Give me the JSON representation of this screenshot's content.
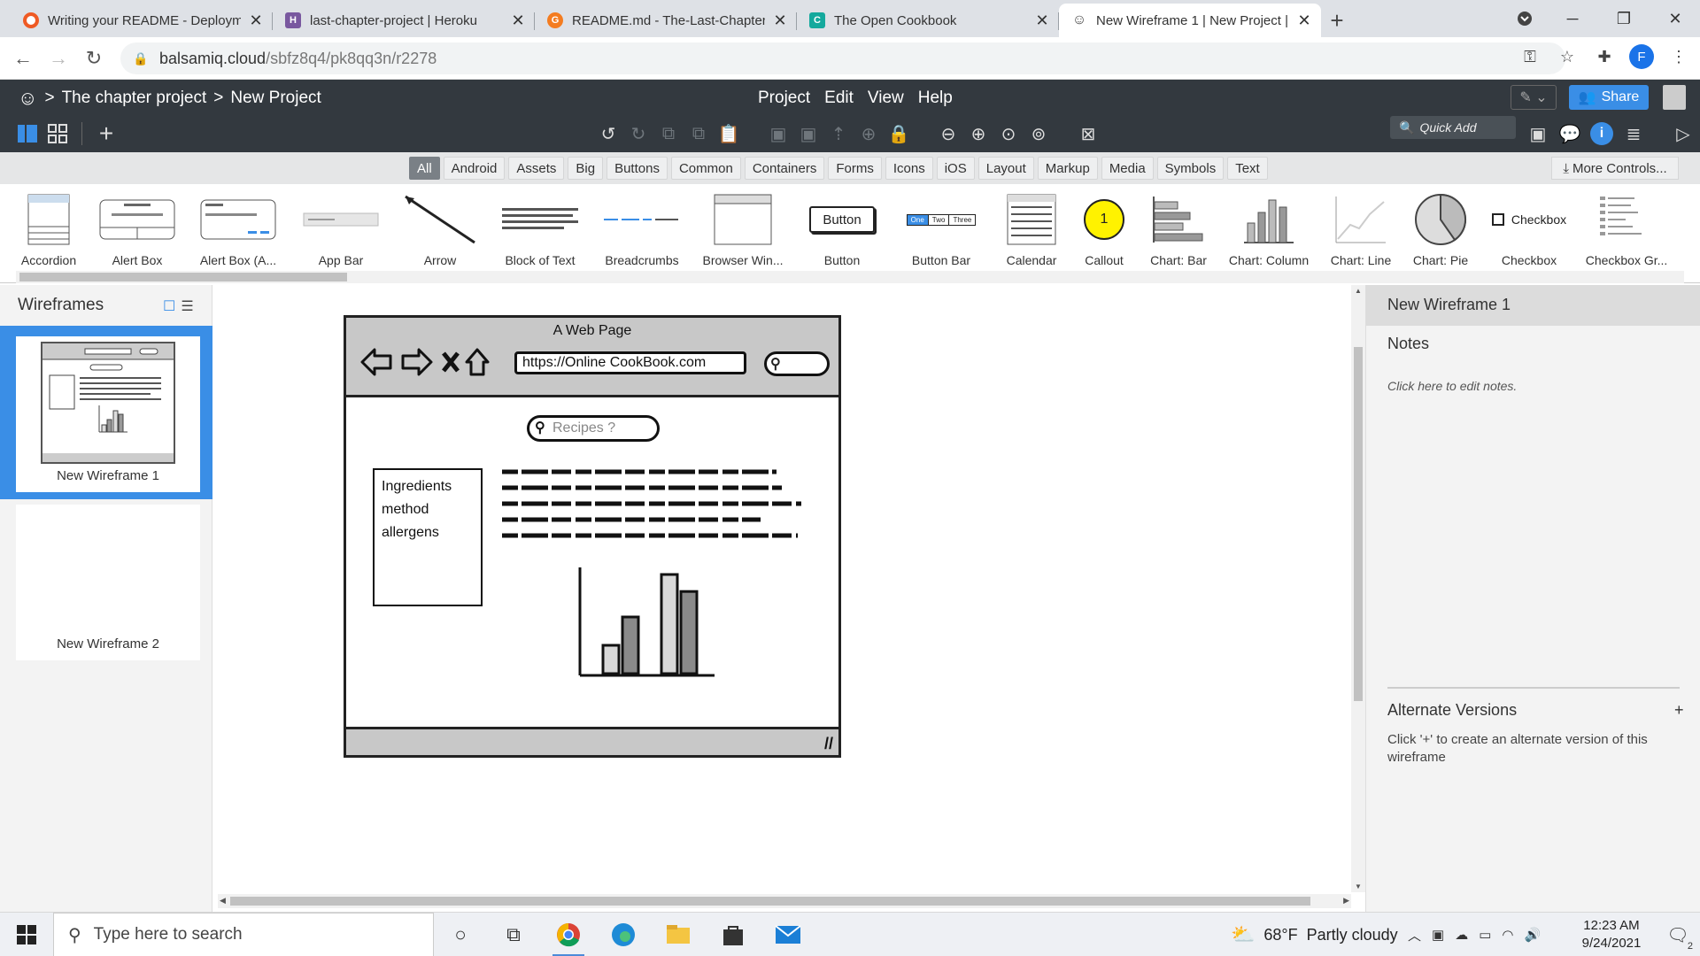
{
  "browser": {
    "tabs": [
      {
        "title": "Writing your README - Deploym",
        "favicon_color": "#ef5a24"
      },
      {
        "title": "last-chapter-project | Heroku",
        "favicon_color": "#79589f",
        "favicon_letter": "H"
      },
      {
        "title": "README.md - The-Last-Chapter",
        "favicon_color": "#f47c20",
        "favicon_letter": "G"
      },
      {
        "title": "The Open Cookbook",
        "favicon_color": "#14a99d",
        "favicon_letter": "C"
      },
      {
        "title": "New Wireframe 1 | New Project |",
        "favicon_color": "#444444",
        "favicon_letter": "☺"
      }
    ],
    "url_host": "balsamiq.cloud",
    "url_path": "/sbfz8q4/pk8qq3n/r2278",
    "profile_letter": "F"
  },
  "app": {
    "breadcrumb": {
      "project": "The chapter project",
      "page": "New Project"
    },
    "menu": [
      "Project",
      "Edit",
      "View",
      "Help"
    ],
    "quick_add": "Quick Add",
    "share_label": "Share",
    "accent": "#3a8ee6",
    "header_bg": "#33393f"
  },
  "categories": {
    "items": [
      "All",
      "Android",
      "Assets",
      "Big",
      "Buttons",
      "Common",
      "Containers",
      "Forms",
      "Icons",
      "iOS",
      "Layout",
      "Markup",
      "Media",
      "Symbols",
      "Text"
    ],
    "active": "All",
    "more_controls": "More Controls..."
  },
  "library": {
    "components": [
      "Accordion",
      "Alert Box",
      "Alert Box (A...",
      "App Bar",
      "Arrow",
      "Block of Text",
      "Breadcrumbs",
      "Browser Win...",
      "Button",
      "Button Bar",
      "Calendar",
      "Callout",
      "Chart: Bar",
      "Chart: Column",
      "Chart: Line",
      "Chart: Pie",
      "Checkbox",
      "Checkbox Gr..."
    ],
    "thumb_button_text": "Button",
    "thumb_buttonbar": [
      "One",
      "Two",
      "Three"
    ],
    "thumb_callout_number": "1",
    "thumb_checkbox_label": "Checkbox"
  },
  "wireframes_panel": {
    "title": "Wireframes",
    "items": [
      {
        "name": "New Wireframe 1",
        "selected": true
      },
      {
        "name": "New Wireframe 2",
        "selected": false
      }
    ]
  },
  "wireframe": {
    "title": "A Web Page",
    "url": "https://Online CookBook.com",
    "search_placeholder": "Recipes ?",
    "list_items": [
      "Ingredients",
      "method",
      "allergens"
    ],
    "chart_columns": [
      {
        "value": 2,
        "shade": "light"
      },
      {
        "value": 4,
        "shade": "dark"
      },
      {
        "value": 7,
        "shade": "light"
      },
      {
        "value": 5.8,
        "shade": "dark"
      }
    ]
  },
  "properties_panel": {
    "title": "New Wireframe 1",
    "notes_label": "Notes",
    "notes_placeholder": "Click here to edit notes.",
    "alt_versions_label": "Alternate Versions",
    "alt_versions_plus": "+",
    "alt_versions_desc": "Click '+' to create an alternate version of this wireframe"
  },
  "taskbar": {
    "search_placeholder": "Type here to search",
    "weather_temp": "68°F",
    "weather_desc": "Partly cloudy",
    "time": "12:23 AM",
    "date": "9/24/2021",
    "notification_count": "2"
  }
}
